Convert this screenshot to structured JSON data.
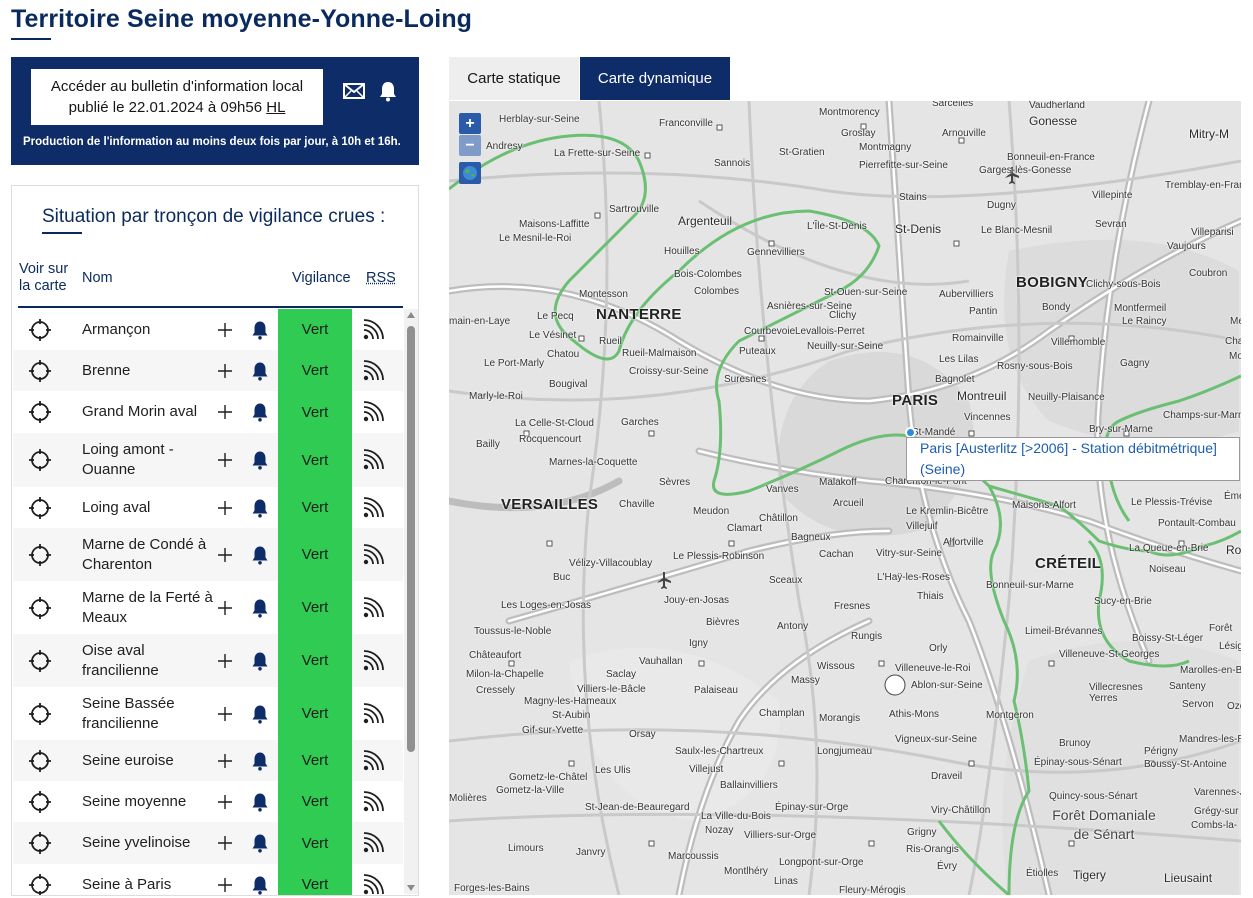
{
  "page": {
    "title": "Territoire Seine moyenne-Yonne-Loing"
  },
  "bulletin": {
    "link_line1": "Accéder au bulletin d'information local",
    "link_line2": "publié le 22.01.2024 à 09h56",
    "link_hl": "HL",
    "note": "Production de l'information au moins deux fois par jour, à 10h et 16h.",
    "mail_icon": "mail-icon",
    "bell_icon": "bell-icon"
  },
  "situation": {
    "title": "Situation par tronçon de vigilance crues :",
    "headers": {
      "voir": "Voir sur la carte",
      "nom": "Nom",
      "vigilance": "Vigilance",
      "rss": "RSS"
    },
    "vigilance_color": "#2fcb53",
    "rows": [
      {
        "name": "Armançon",
        "vigilance": "Vert"
      },
      {
        "name": "Brenne",
        "vigilance": "Vert"
      },
      {
        "name": "Grand Morin aval",
        "vigilance": "Vert"
      },
      {
        "name": "Loing amont - Ouanne",
        "vigilance": "Vert"
      },
      {
        "name": "Loing aval",
        "vigilance": "Vert"
      },
      {
        "name": "Marne de Condé à Charenton",
        "vigilance": "Vert"
      },
      {
        "name": "Marne de la Ferté à Meaux",
        "vigilance": "Vert"
      },
      {
        "name": "Oise aval francilienne",
        "vigilance": "Vert"
      },
      {
        "name": "Seine Bassée francilienne",
        "vigilance": "Vert"
      },
      {
        "name": "Seine euroise",
        "vigilance": "Vert"
      },
      {
        "name": "Seine moyenne",
        "vigilance": "Vert"
      },
      {
        "name": "Seine yvelinoise",
        "vigilance": "Vert"
      },
      {
        "name": "Seine à Paris",
        "vigilance": "Vert"
      }
    ]
  },
  "tabs": [
    {
      "label": "Carte statique",
      "active": false
    },
    {
      "label": "Carte dynamique",
      "active": true
    }
  ],
  "map": {
    "zoom_in": "+",
    "zoom_out": "−",
    "tooltip": "Paris [Austerlitz [>2006] - Station débitmétrique] (Seine)",
    "labels": [
      "Sarcelles",
      "Vaudherland",
      "Montmorency",
      "Gonesse",
      "Herblay-sur-Seine",
      "Franconville",
      "Groslay",
      "Arnouville",
      "Mitry-M",
      "St-Gratien",
      "Montmagny",
      "Andresy",
      "La Frette-sur-Seine",
      "Sannois",
      "Pierrefitte-sur-Seine",
      "Bonneuil-en-France",
      "Garges-lès-Gonesse",
      "Tremblay-en-Fran",
      "Sartrouville",
      "Stains",
      "Dugny",
      "Maisons-Laffitte",
      "Argenteuil",
      "Villepinte",
      "Le Mesnil-le-Roi",
      "L'Île-St-Denis",
      "St-Denis",
      "Le Blanc-Mesnil",
      "Sevran",
      "Villeparisi",
      "Houilles",
      "Gennevilliers",
      "Vaujours",
      "Bois-Colombes",
      "Coubron",
      "Clichy-sous-Bois",
      "Montesson",
      "St-Ouen-sur-Seine",
      "Aubervilliers",
      "BOBIGNY",
      "Montfermeil",
      "Bondy",
      "NANTERRE",
      "Pantin",
      "Le Raincy",
      "main-en-Laye",
      "Le Vésinet",
      "Clichy",
      "Levallois-Perret",
      "Romainville",
      "Villemomble",
      "Rueil-Malmaison",
      "Neuilly-sur-Seine",
      "Les Lilas",
      "Rosny-sous-Bois",
      "Le Port-Marly",
      "Croissy-sur-Seine",
      "Puteaux",
      "Bagnolet",
      "Gagny",
      "Suresnes",
      "Bougival",
      "Montreuil",
      "Neuilly-Plaisance",
      "Marly-le-Roi",
      "PARIS",
      "Vincennes",
      "Bry-sur-Marne",
      "La Celle-St-Cloud",
      "Garches",
      "St-Mandé",
      "Champs-sur-Marne",
      "Rocquencourt",
      "Bailly",
      "Marnes-la-Coquette",
      "Sèvres",
      "Vanves",
      "Malakoff",
      "Charenton-le-Pont",
      "VERSAILLES",
      "Chaville",
      "Meudon",
      "Arcueil",
      "Le Kremlin-Bicêtre",
      "Maisons-Alfort",
      "Le Plessis-Trévise",
      "Pontault-Combau",
      "Châtillon",
      "Villejuif",
      "Clamart",
      "Bagneux",
      "Alfortville",
      "CRÉTEIL",
      "La Queue-en-Brie",
      "Le Plessis-Robinson",
      "Cachan",
      "Vitry-sur-Seine",
      "Noiseau",
      "Vélizy-Villacoublay",
      "Sceaux",
      "L'Haÿ-les-Roses",
      "Bonneuil-sur-Marne",
      "Buc",
      "Jouy-en-Josas",
      "Fresnes",
      "Thiais",
      "Sucy-en-Brie",
      "Les Loges-en-Josas",
      "Bièvres",
      "Antony",
      "Rungis",
      "Limeil-Brévannes",
      "Boissy-St-Léger",
      "Toussus-le-Noble",
      "Igny",
      "Orly",
      "Villeneuve-St-Georges",
      "Châteaufort",
      "Vauhallan",
      "Wissous",
      "Marolles-en-Bri",
      "Milon-la-Chapelle",
      "Saclay",
      "Villeneuve-le-Roi",
      "Massy",
      "Ablon-sur-Seine",
      "Villecresnes",
      "Santeny",
      "Cressely",
      "Villiers-le-Bâcle",
      "Palaiseau",
      "Yerres",
      "Servon",
      "Magny-les-Hameaux",
      "St-Aubin",
      "Champlan",
      "Athis-Mons",
      "Montgeron",
      "Gif-sur-Yvette",
      "Orsay",
      "Morangis",
      "Vigneux-sur-Seine",
      "Mandres-les-Ro",
      "Brunoy",
      "Saulx-les-Chartreux",
      "Longjumeau",
      "Périgny",
      "Les Ulis",
      "Villejust",
      "Épinay-sous-Sénart",
      "Boussy-St-Antoine",
      "Gometz-le-Châtel",
      "Gometz-la-Ville",
      "Draveil",
      "Ballainvilliers",
      "Varennes-J",
      "Molières",
      "Épinay-sur-Orge",
      "Quincy-sous-Sénart",
      "Grégy-sur",
      "St-Jean-de-Beauregard",
      "La Ville-du-Bois",
      "Viry-Châtillon",
      "Combs-la-",
      "Nozay",
      "Villiers-sur-Orge",
      "Grigny",
      "Forêt Domaniale de Sénart",
      "Limours",
      "Janvry",
      "Ris-Orangis",
      "Marcoussis",
      "Longpont-sur-Orge",
      "Montlhéry",
      "Linas",
      "Évry",
      "Étiolles",
      "Tigery",
      "Lieusaint",
      "Forges-les-Bains",
      "Fleury-Mérogis",
      "Forêt",
      "Lésig",
      "Émera",
      "Rois",
      "Char",
      "Mons",
      "Mens",
      "Ozoir",
      "Le Pecq",
      "Chatou",
      "Rueil",
      "Colombes",
      "Courbevoie",
      "Asnières-sur-Seine"
    ]
  }
}
